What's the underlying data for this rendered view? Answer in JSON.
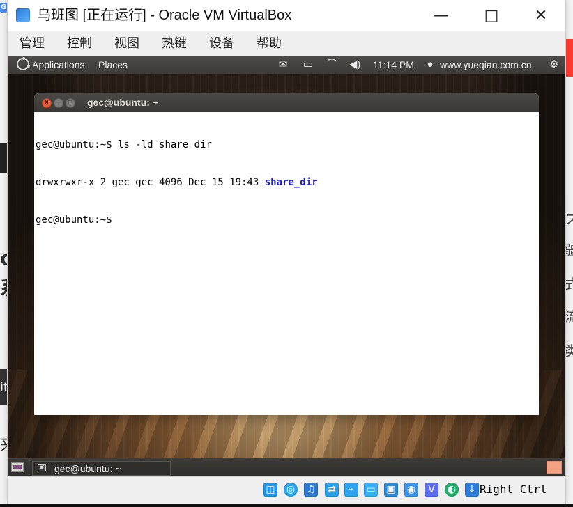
{
  "background_fragments": {
    "left_letter_1": "o",
    "left_letter_2": "系",
    "left_letter_3": "来",
    "left_letter_4": "it",
    "right_letter_1": "ス",
    "right_letter_2": "疆",
    "right_letter_3": "式",
    "right_letter_4": "流",
    "right_letter_5": "类",
    "browser_badge": "G"
  },
  "vbox": {
    "title": "乌班图 [正在运行] - Oracle VM VirtualBox",
    "controls": {
      "minimize": "—",
      "maximize": "□",
      "close": "✕"
    },
    "menu": [
      "管理",
      "控制",
      "视图",
      "热键",
      "设备",
      "帮助"
    ],
    "statusbar": {
      "right_ctrl": "Right Ctrl",
      "icons": [
        "hard-disk-icon",
        "optical-drive-icon",
        "audio-icon",
        "network-icon",
        "usb-icon",
        "shared-folder-icon",
        "display-icon",
        "video-recording-icon",
        "virtualization-icon",
        "mouse-integration-icon",
        "host-key-icon"
      ]
    }
  },
  "guest": {
    "top_panel": {
      "applications": "Applications",
      "places": "Places",
      "time": "11:14 PM",
      "user": "www.yueqian.com.cn"
    },
    "terminal": {
      "title": "gec@ubuntu: ~",
      "lines": [
        {
          "prompt": "gec@ubuntu:~$ ",
          "command": "ls -ld share_dir"
        },
        {
          "listing_prefix": "drwxrwxr-x 2 gec gec 4096 Dec 15 19:43 ",
          "directory_name": "share_dir"
        },
        {
          "prompt": "gec@ubuntu:~$"
        }
      ]
    },
    "bottom_panel": {
      "task_label": "gec@ubuntu: ~"
    }
  }
}
